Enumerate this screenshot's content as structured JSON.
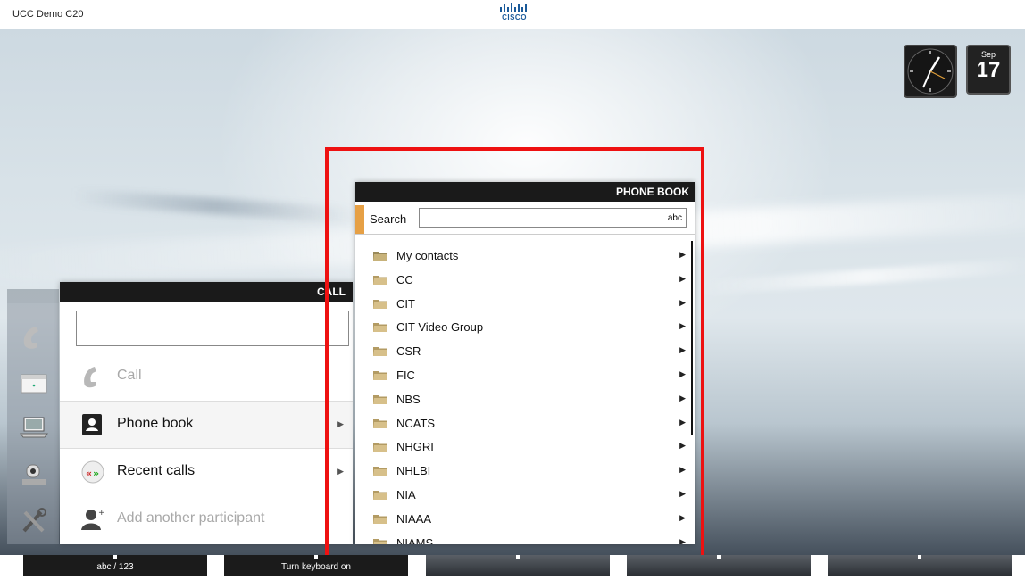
{
  "top_bar": {
    "device_name": "UCC Demo C20",
    "logo_text": "CISCO"
  },
  "widgets": {
    "calendar_month": "Sep",
    "calendar_day": "17",
    "clock_icon": "analog-clock-icon"
  },
  "side_icons": [
    "phone-handset-icon",
    "calendar-icon",
    "laptop-icon",
    "camera-icon",
    "tools-icon"
  ],
  "call_panel": {
    "header": "CALL",
    "input_value": "",
    "items": [
      {
        "label": "Call",
        "icon": "phone-handset-icon",
        "enabled": false,
        "has_arrow": false
      },
      {
        "label": "Phone book",
        "icon": "phonebook-icon",
        "enabled": true,
        "has_arrow": true
      },
      {
        "label": "Recent calls",
        "icon": "recent-calls-icon",
        "enabled": true,
        "has_arrow": true
      },
      {
        "label": "Add another participant",
        "icon": "add-participant-icon",
        "enabled": false,
        "has_arrow": false
      }
    ]
  },
  "phone_book": {
    "header": "PHONE BOOK",
    "search_label": "Search",
    "search_value": "abc",
    "entries": [
      "My contacts",
      "CC",
      "CIT",
      "CIT Video Group",
      "CSR",
      "FIC",
      "NBS",
      "NCATS",
      "NHGRI",
      "NHLBI",
      "NIA",
      "NIAAA",
      "NIAMS"
    ]
  },
  "bottom_bar": {
    "keys": [
      "abc / 123",
      "Turn keyboard on",
      "",
      "",
      ""
    ]
  },
  "colors": {
    "highlight": "#ee1111",
    "search_accent": "#e6a045",
    "header_bg": "#1a1a1a"
  }
}
